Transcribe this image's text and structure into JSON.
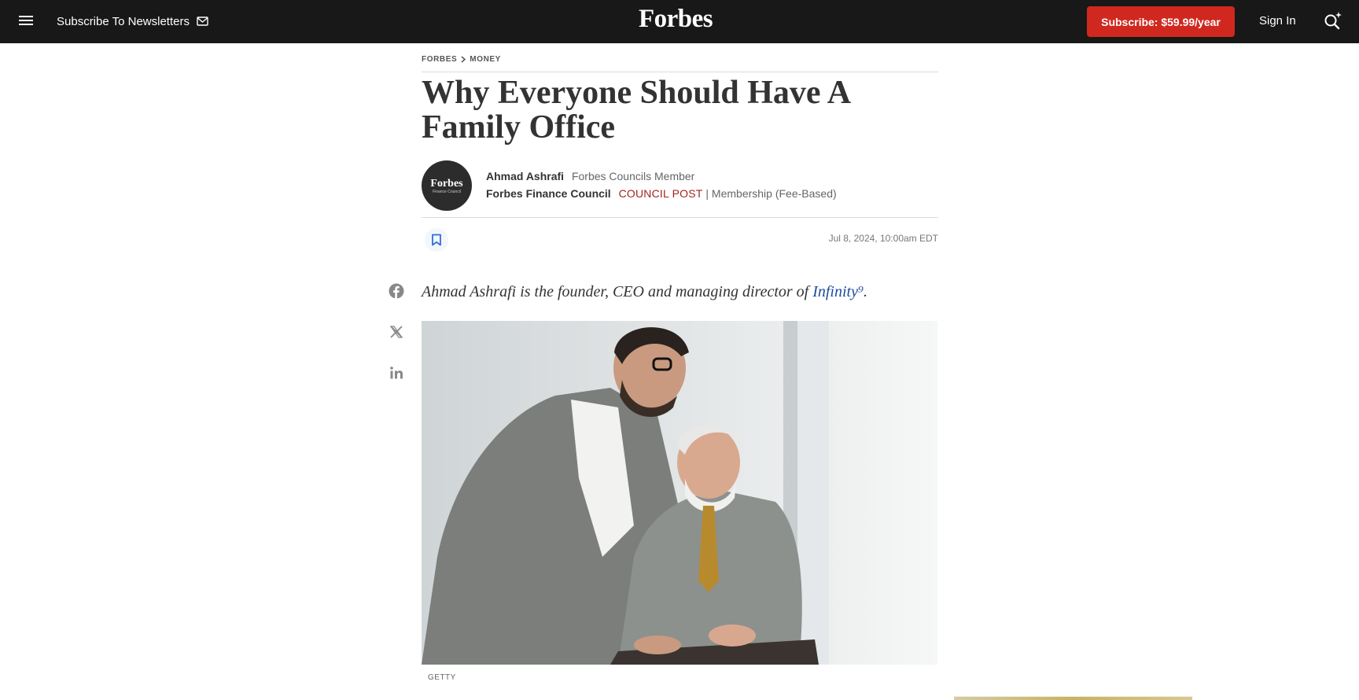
{
  "nav": {
    "newsletter_label": "Subscribe To Newsletters",
    "logo_text": "Forbes",
    "subscribe_label": "Subscribe: $59.99/year",
    "signin_label": "Sign In",
    "menu_icon": "hamburger-menu-icon",
    "mail_icon": "mail-icon",
    "search_icon": "ai-search-icon"
  },
  "breadcrumb": [
    "FORBES",
    "MONEY"
  ],
  "article": {
    "title": "Why Everyone Should Have A Family Office",
    "author": "Ahmad Ashrafi",
    "author_role": "Forbes Councils Member",
    "council": "Forbes Finance Council",
    "post_type": "COUNCIL POST",
    "membership": "| Membership (Fee-Based)",
    "avatar_logo": "Forbes",
    "avatar_sub": "Finance Council",
    "date": "Jul 8, 2024, 10:00am EDT",
    "lede_text": "Ahmad Ashrafi is the founder, CEO and managing director of ",
    "lede_link": "Infinity⁹",
    "lede_end": ".",
    "image_caption": "GETTY"
  },
  "share": [
    "facebook-icon",
    "x-icon",
    "linkedin-icon"
  ],
  "colors": {
    "nav_bg": "#181818",
    "subscribe_bg": "#d0281f",
    "council_post": "#a3231e",
    "link": "#1e4a9e",
    "bookmark": "#2e6fd6"
  }
}
